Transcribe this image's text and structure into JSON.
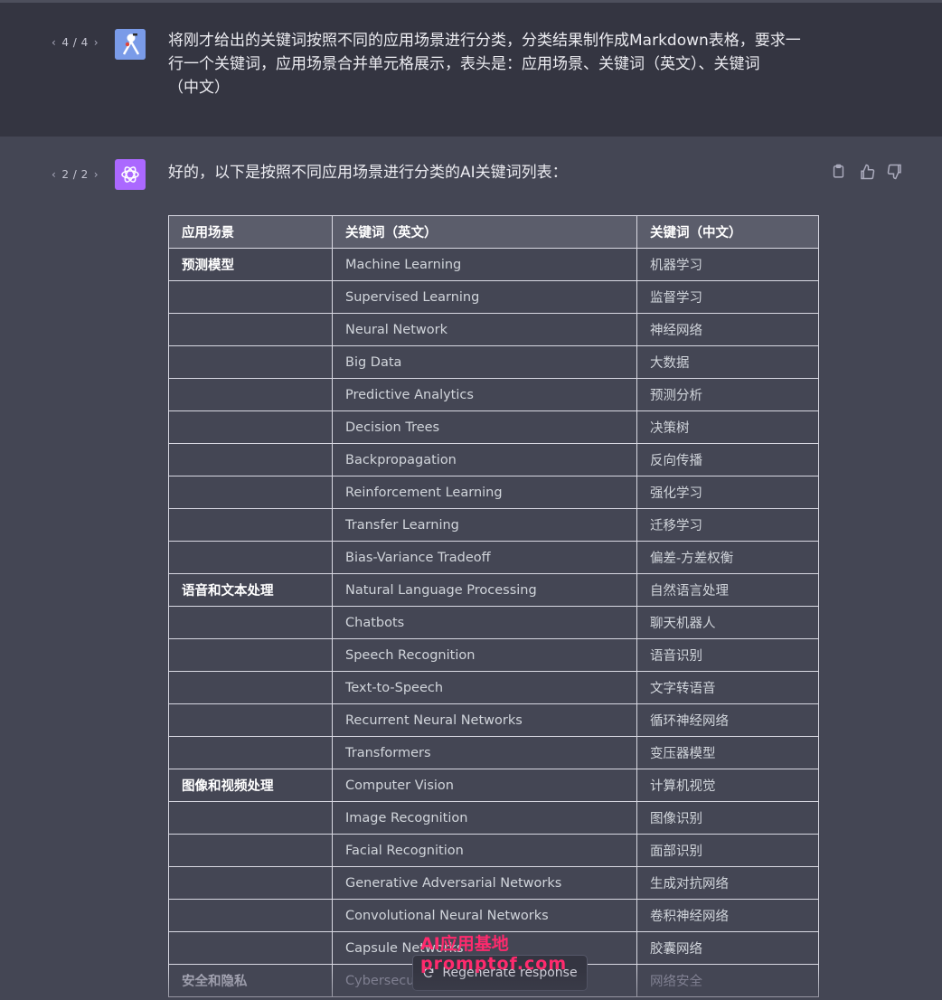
{
  "user_message": {
    "pager": {
      "current": "4",
      "total": "4",
      "text": "4 / 4"
    },
    "lines": [
      "将刚才给出的关键词按照不同的应用场景进行分类，分类结果制作成Markdown表格，要求一",
      "行一个关键词，应用场景合并单元格展示，表头是：应用场景、关键词（英文）、关键词",
      "（中文）"
    ]
  },
  "assistant_message": {
    "pager": {
      "text": "2 / 2"
    },
    "intro": "好的，以下是按照不同应用场景进行分类的AI关键词列表：",
    "table": {
      "headers": [
        "应用场景",
        "关键词（英文）",
        "关键词（中文）"
      ],
      "rows": [
        {
          "scene": "预测模型",
          "en": "Machine Learning",
          "zh": "机器学习"
        },
        {
          "scene": "",
          "en": "Supervised Learning",
          "zh": "监督学习"
        },
        {
          "scene": "",
          "en": "Neural Network",
          "zh": "神经网络"
        },
        {
          "scene": "",
          "en": "Big Data",
          "zh": "大数据"
        },
        {
          "scene": "",
          "en": "Predictive Analytics",
          "zh": "预测分析"
        },
        {
          "scene": "",
          "en": "Decision Trees",
          "zh": "决策树"
        },
        {
          "scene": "",
          "en": "Backpropagation",
          "zh": "反向传播"
        },
        {
          "scene": "",
          "en": "Reinforcement Learning",
          "zh": "强化学习"
        },
        {
          "scene": "",
          "en": "Transfer Learning",
          "zh": "迁移学习"
        },
        {
          "scene": "",
          "en": "Bias-Variance Tradeoff",
          "zh": "偏差-方差权衡"
        },
        {
          "scene": "语音和文本处理",
          "en": "Natural Language Processing",
          "zh": "自然语言处理"
        },
        {
          "scene": "",
          "en": "Chatbots",
          "zh": "聊天机器人"
        },
        {
          "scene": "",
          "en": "Speech Recognition",
          "zh": "语音识别"
        },
        {
          "scene": "",
          "en": "Text-to-Speech",
          "zh": "文字转语音"
        },
        {
          "scene": "",
          "en": "Recurrent Neural Networks",
          "zh": "循环神经网络"
        },
        {
          "scene": "",
          "en": "Transformers",
          "zh": "变压器模型"
        },
        {
          "scene": "图像和视频处理",
          "en": "Computer Vision",
          "zh": "计算机视觉"
        },
        {
          "scene": "",
          "en": "Image Recognition",
          "zh": "图像识别"
        },
        {
          "scene": "",
          "en": "Facial Recognition",
          "zh": "面部识别"
        },
        {
          "scene": "",
          "en": "Generative Adversarial Networks",
          "zh": "生成对抗网络"
        },
        {
          "scene": "",
          "en": "Convolutional Neural Networks",
          "zh": "卷积神经网络"
        },
        {
          "scene": "",
          "en": "Capsule Networks",
          "zh": "胶囊网络"
        },
        {
          "scene": "安全和隐私",
          "en": "Cybersecurity",
          "zh": "网络安全"
        }
      ]
    }
  },
  "regenerate_label": "Regenerate response",
  "watermark": {
    "line1": "AI应用基地",
    "line2": "promptof.com"
  },
  "colors": {
    "user_bg": "#343541",
    "assistant_bg": "#444654",
    "gpt_avatar": "#ab68ff",
    "watermark": "#ff2a6d"
  }
}
